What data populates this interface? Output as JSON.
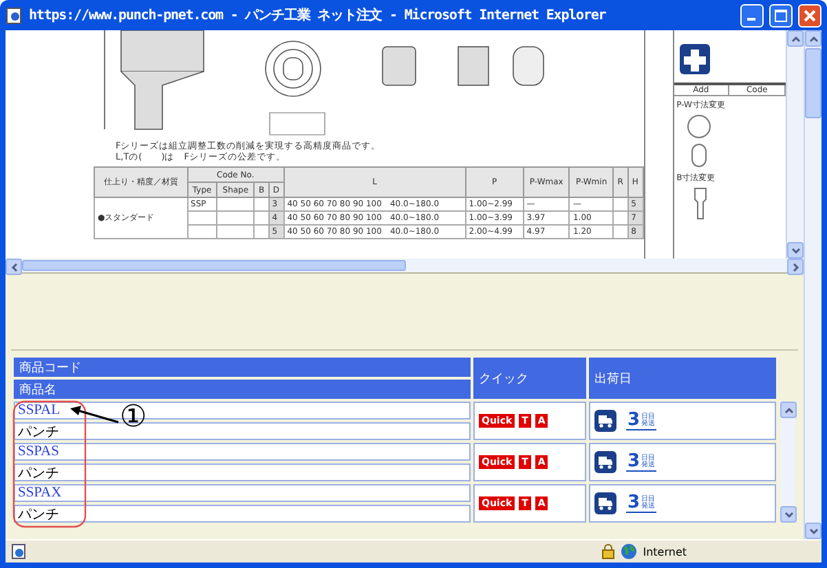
{
  "window": {
    "title": "https://www.punch-pnet.com - パンチ工業 ネット注文 - Microsoft Internet Explorer"
  },
  "catalog": {
    "notes": [
      "Fシリーズは組立調整工数の削減を実現する高精度商品です。",
      "L,Tの(　　)は　Fシリーズの公差です。"
    ],
    "table_headers": [
      "仕上り・精度／材質",
      "Code No.",
      "Type",
      "Shape",
      "B",
      "D",
      "L",
      "P",
      "P-Wmax",
      "P-Wmin",
      "R",
      "H"
    ],
    "group_label": "●スタンダード",
    "type": "SSP",
    "rows": [
      {
        "d": "3",
        "l": "40 50 60 70 80 90 100",
        "l_range": "40.0~180.0",
        "p": "1.00~2.99",
        "pw_max": "—",
        "pw_min": "—",
        "h": "5"
      },
      {
        "d": "4",
        "l": "40 50 60 70 80 90 100",
        "l_range": "40.0~180.0",
        "p": "1.00~3.99",
        "pw_max": "3.97",
        "pw_min": "1.00",
        "h": "7"
      },
      {
        "d": "5",
        "l": "40 50 60 70 80 90 100",
        "l_range": "40.0~180.0",
        "p": "2.00~4.99",
        "pw_max": "4.97",
        "pw_min": "1.20",
        "h": "8"
      }
    ],
    "side": {
      "headers": [
        "Add",
        "Code"
      ],
      "items": [
        "P-W寸法変更",
        "B寸法変更"
      ]
    }
  },
  "product_table": {
    "columns": [
      "商品コード",
      "商品名",
      "クイック",
      "出荷日"
    ],
    "rows": [
      {
        "code": "SSPAL",
        "name": "パンチ",
        "badges": [
          "Quick",
          "T",
          "A"
        ],
        "ship_day": "3",
        "ship_label": [
          "日目",
          "発送"
        ]
      },
      {
        "code": "SSPAS",
        "name": "パンチ",
        "badges": [
          "Quick",
          "T",
          "A"
        ],
        "ship_day": "3",
        "ship_label": [
          "日目",
          "発送"
        ]
      },
      {
        "code": "SSPAX",
        "name": "パンチ",
        "badges": [
          "Quick",
          "T",
          "A"
        ],
        "ship_day": "3",
        "ship_label": [
          "日目",
          "発送"
        ]
      }
    ]
  },
  "annotation": {
    "label": "①"
  },
  "status_bar": {
    "zone": "Internet"
  }
}
